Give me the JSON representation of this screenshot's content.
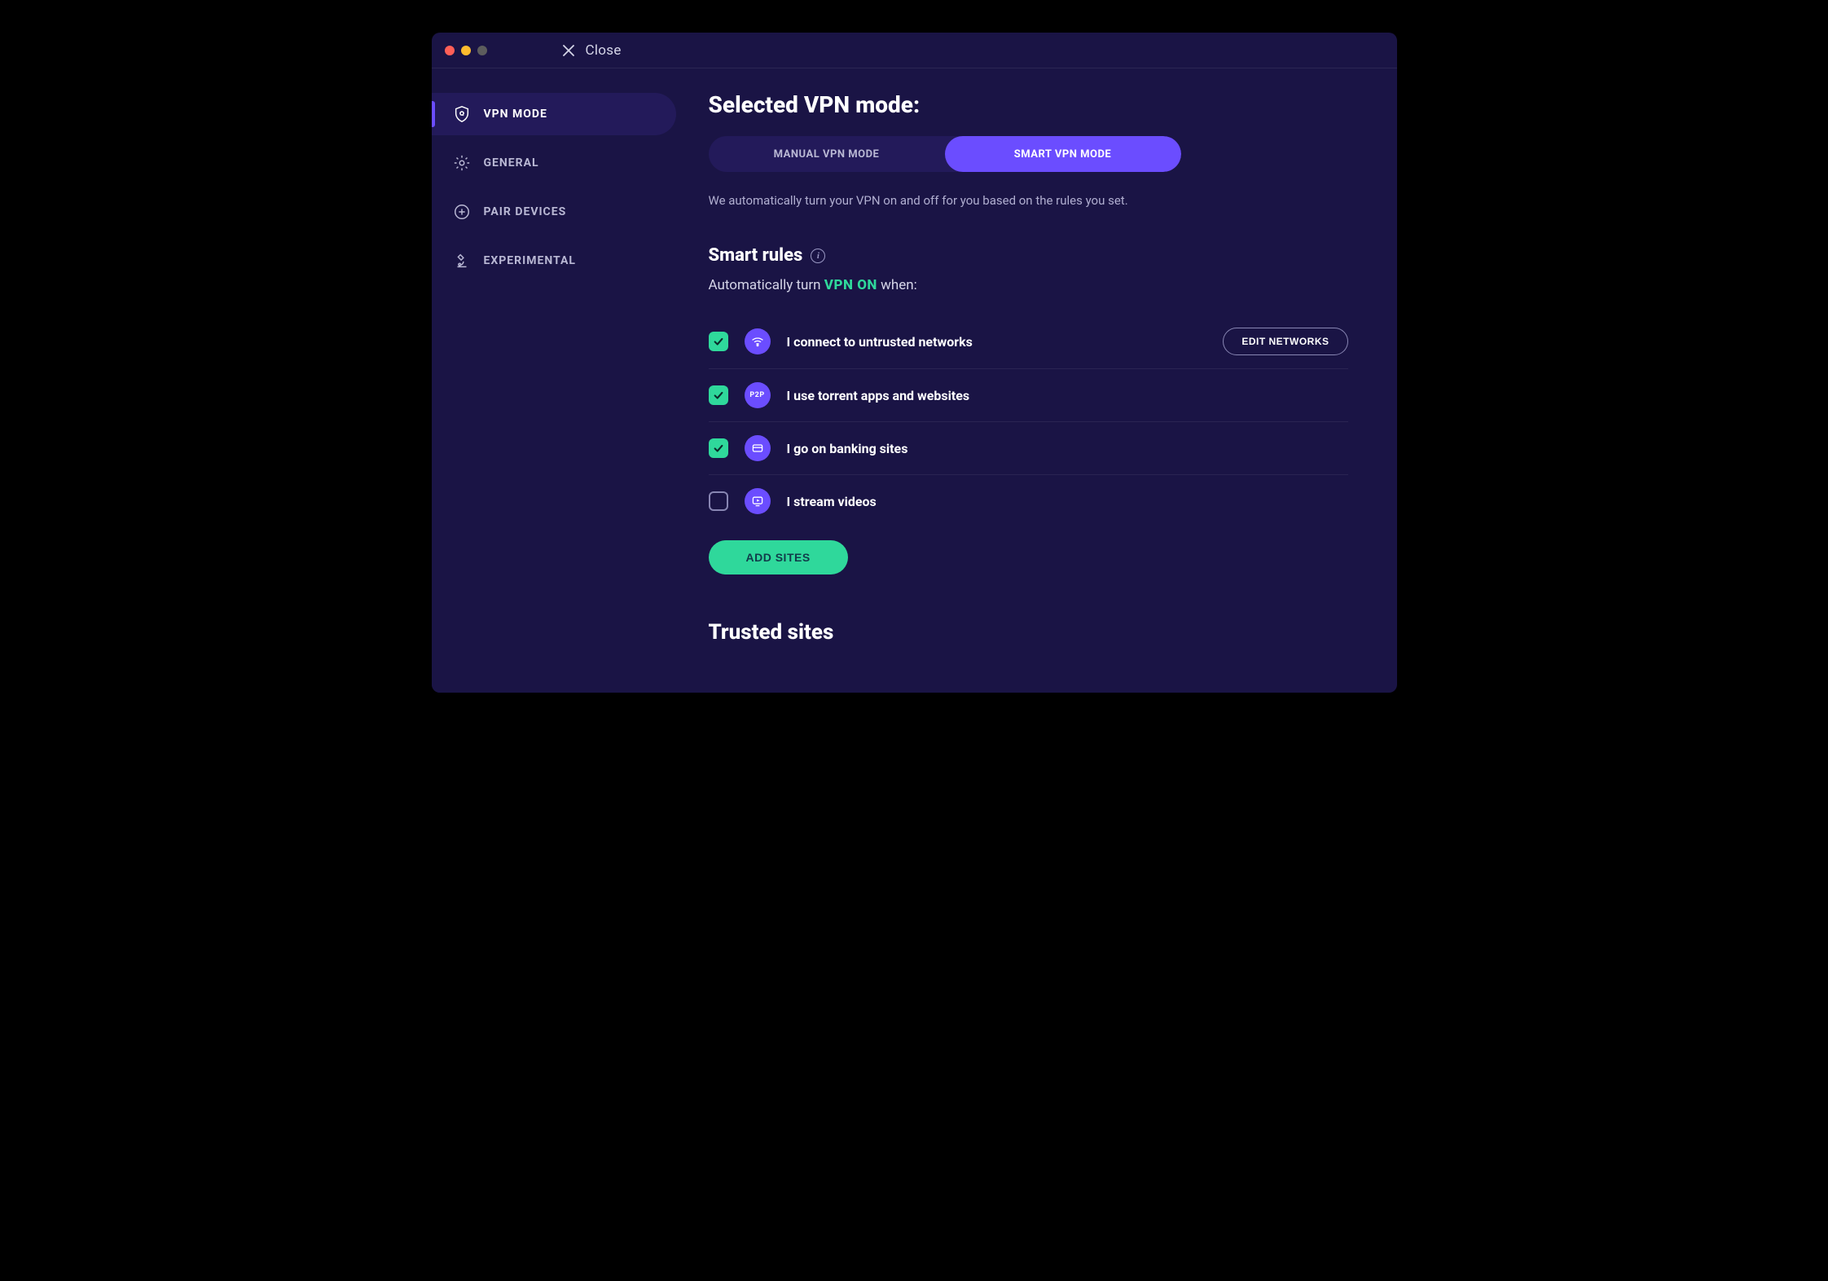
{
  "header": {
    "close_label": "Close"
  },
  "sidebar": {
    "items": [
      {
        "label": "VPN MODE",
        "icon": "shield-gear-icon",
        "active": true
      },
      {
        "label": "GENERAL",
        "icon": "gear-icon",
        "active": false
      },
      {
        "label": "PAIR DEVICES",
        "icon": "plus-circle-icon",
        "active": false
      },
      {
        "label": "EXPERIMENTAL",
        "icon": "microscope-icon",
        "active": false
      }
    ]
  },
  "main": {
    "title": "Selected VPN mode:",
    "modes": {
      "manual": "MANUAL VPN MODE",
      "smart": "SMART VPN MODE",
      "selected": "smart"
    },
    "mode_description": "We automatically turn your VPN on and off for you based on the rules you set.",
    "smart_rules": {
      "heading": "Smart rules",
      "subline_prefix": "Automatically turn ",
      "subline_vpn": "VPN ON",
      "subline_suffix": " when:",
      "rules": [
        {
          "checked": true,
          "icon": "wifi-icon",
          "label": "I connect to untrusted networks",
          "action": "EDIT NETWORKS"
        },
        {
          "checked": true,
          "icon": "p2p-icon",
          "label": "I use torrent apps and websites"
        },
        {
          "checked": true,
          "icon": "bank-icon",
          "label": "I go on banking sites"
        },
        {
          "checked": false,
          "icon": "stream-icon",
          "label": "I stream videos"
        }
      ],
      "add_button": "ADD SITES"
    },
    "trusted_sites_heading": "Trusted sites"
  },
  "colors": {
    "accent": "#6b4dff",
    "green": "#2fd89b",
    "bg": "#1a1445"
  }
}
